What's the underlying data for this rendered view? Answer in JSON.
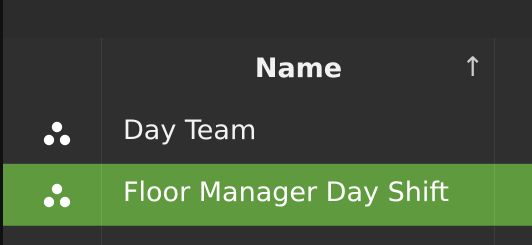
{
  "grid": {
    "header": {
      "name_label": "Name",
      "sort_indicator": "↑"
    },
    "rows": [
      {
        "name": "Day Team",
        "icon": "group-icon",
        "selected": false
      },
      {
        "name": "Floor Manager Day Shift",
        "icon": "group-icon",
        "selected": true
      }
    ]
  },
  "colors": {
    "background": "#2f2f2f",
    "selected_row": "#5f9b3e",
    "text": "#f3f3f3",
    "grid_line": "#3e3e3e"
  }
}
